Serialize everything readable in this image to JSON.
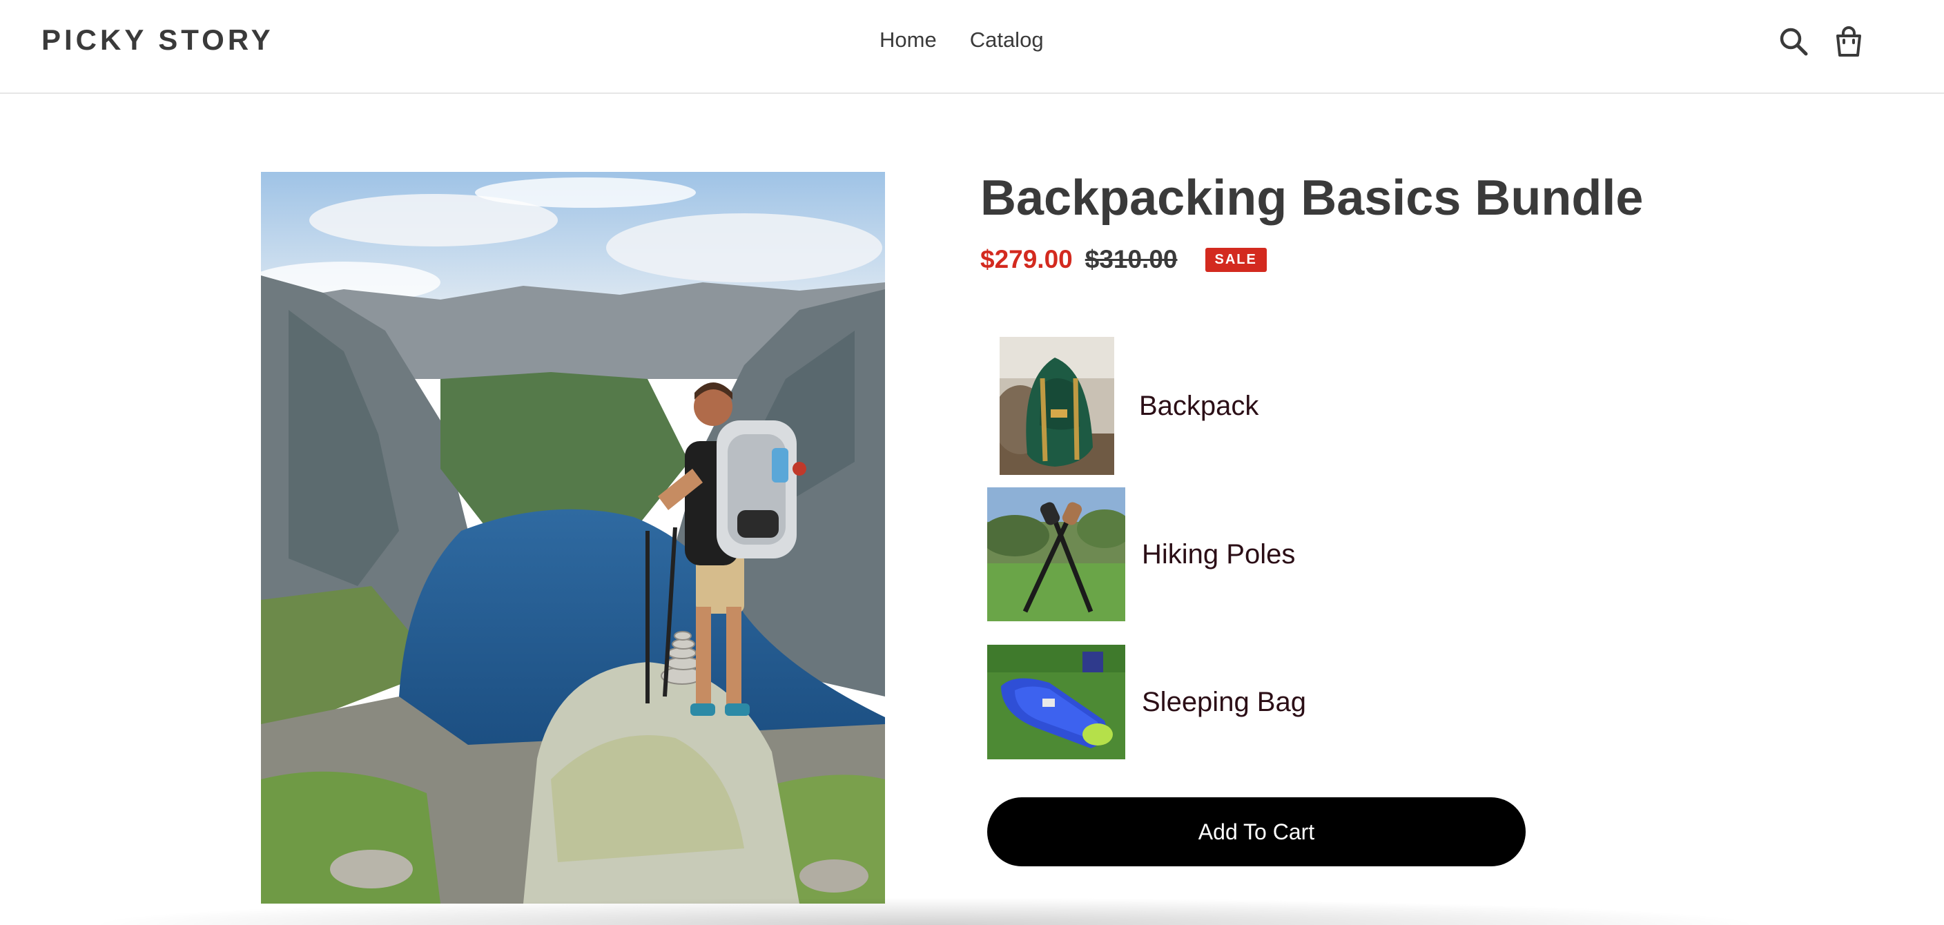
{
  "header": {
    "logo": "PICKY STORY",
    "nav": [
      {
        "label": "Home"
      },
      {
        "label": "Catalog"
      }
    ],
    "icons": [
      "search-icon",
      "cart-icon"
    ]
  },
  "product": {
    "title": "Backpacking Basics Bundle",
    "price": "$279.00",
    "compare_price": "$310.00",
    "badge": "SALE",
    "image_alt": "Hiker with backpack overlooking a fjord",
    "colors": {
      "sale": "#d32a1f",
      "text": "#3a3a3a",
      "button": "#000000"
    }
  },
  "bundle": {
    "items": [
      {
        "label": "Backpack",
        "thumb": "backpack-thumbnail"
      },
      {
        "label": "Hiking Poles",
        "thumb": "hiking-poles-thumbnail"
      },
      {
        "label": "Sleeping Bag",
        "thumb": "sleeping-bag-thumbnail"
      }
    ],
    "add_to_cart": "Add To Cart"
  }
}
